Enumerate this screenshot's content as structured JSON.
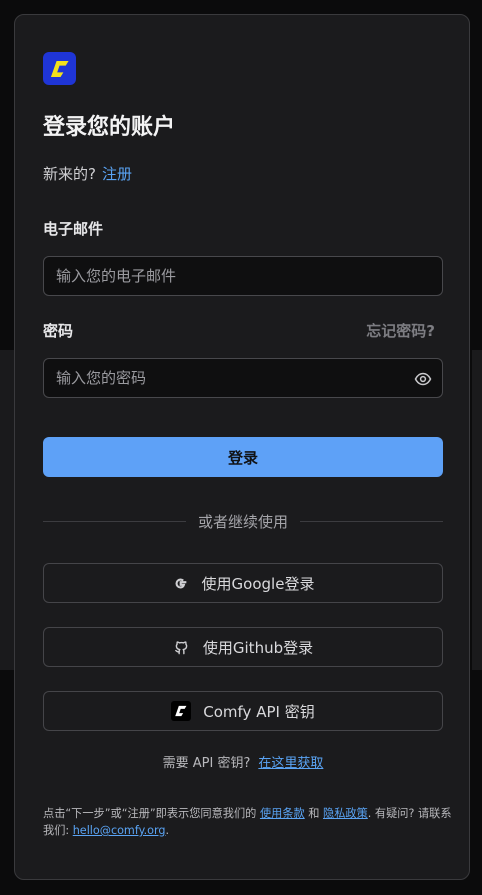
{
  "heading": "登录您的账户",
  "signup": {
    "prompt": "新来的?",
    "link": "注册"
  },
  "email": {
    "label": "电子邮件",
    "placeholder": "输入您的电子邮件"
  },
  "password": {
    "label": "密码",
    "forgot": "忘记密码?",
    "placeholder": "输入您的密码"
  },
  "login_button": "登录",
  "divider": "或者继续使用",
  "oauth": {
    "google": "使用Google登录",
    "github": "使用Github登录",
    "api_key": "Comfy API 密钥"
  },
  "api_hint": {
    "text": "需要 API 密钥?",
    "link": "在这里获取"
  },
  "terms": {
    "prefix": "点击“下一步”或“注册”即表示您同意我们的",
    "terms_link": "使用条款",
    "and": "和",
    "privacy_link": "隐私政策",
    "question": ". 有疑问? 请联系我们:",
    "email": "hello@comfy.org",
    "suffix": "."
  },
  "colors": {
    "accent": "#5ea1f7",
    "link": "#5aa4f5",
    "logo_bg": "#1f35d6",
    "logo_mark": "#f3e11c",
    "card_bg": "#1b1b1d"
  },
  "icons": {
    "logo": "comfy-logo-icon",
    "eye": "eye-icon",
    "google": "google-icon",
    "github": "github-icon",
    "comfy": "comfy-icon"
  }
}
